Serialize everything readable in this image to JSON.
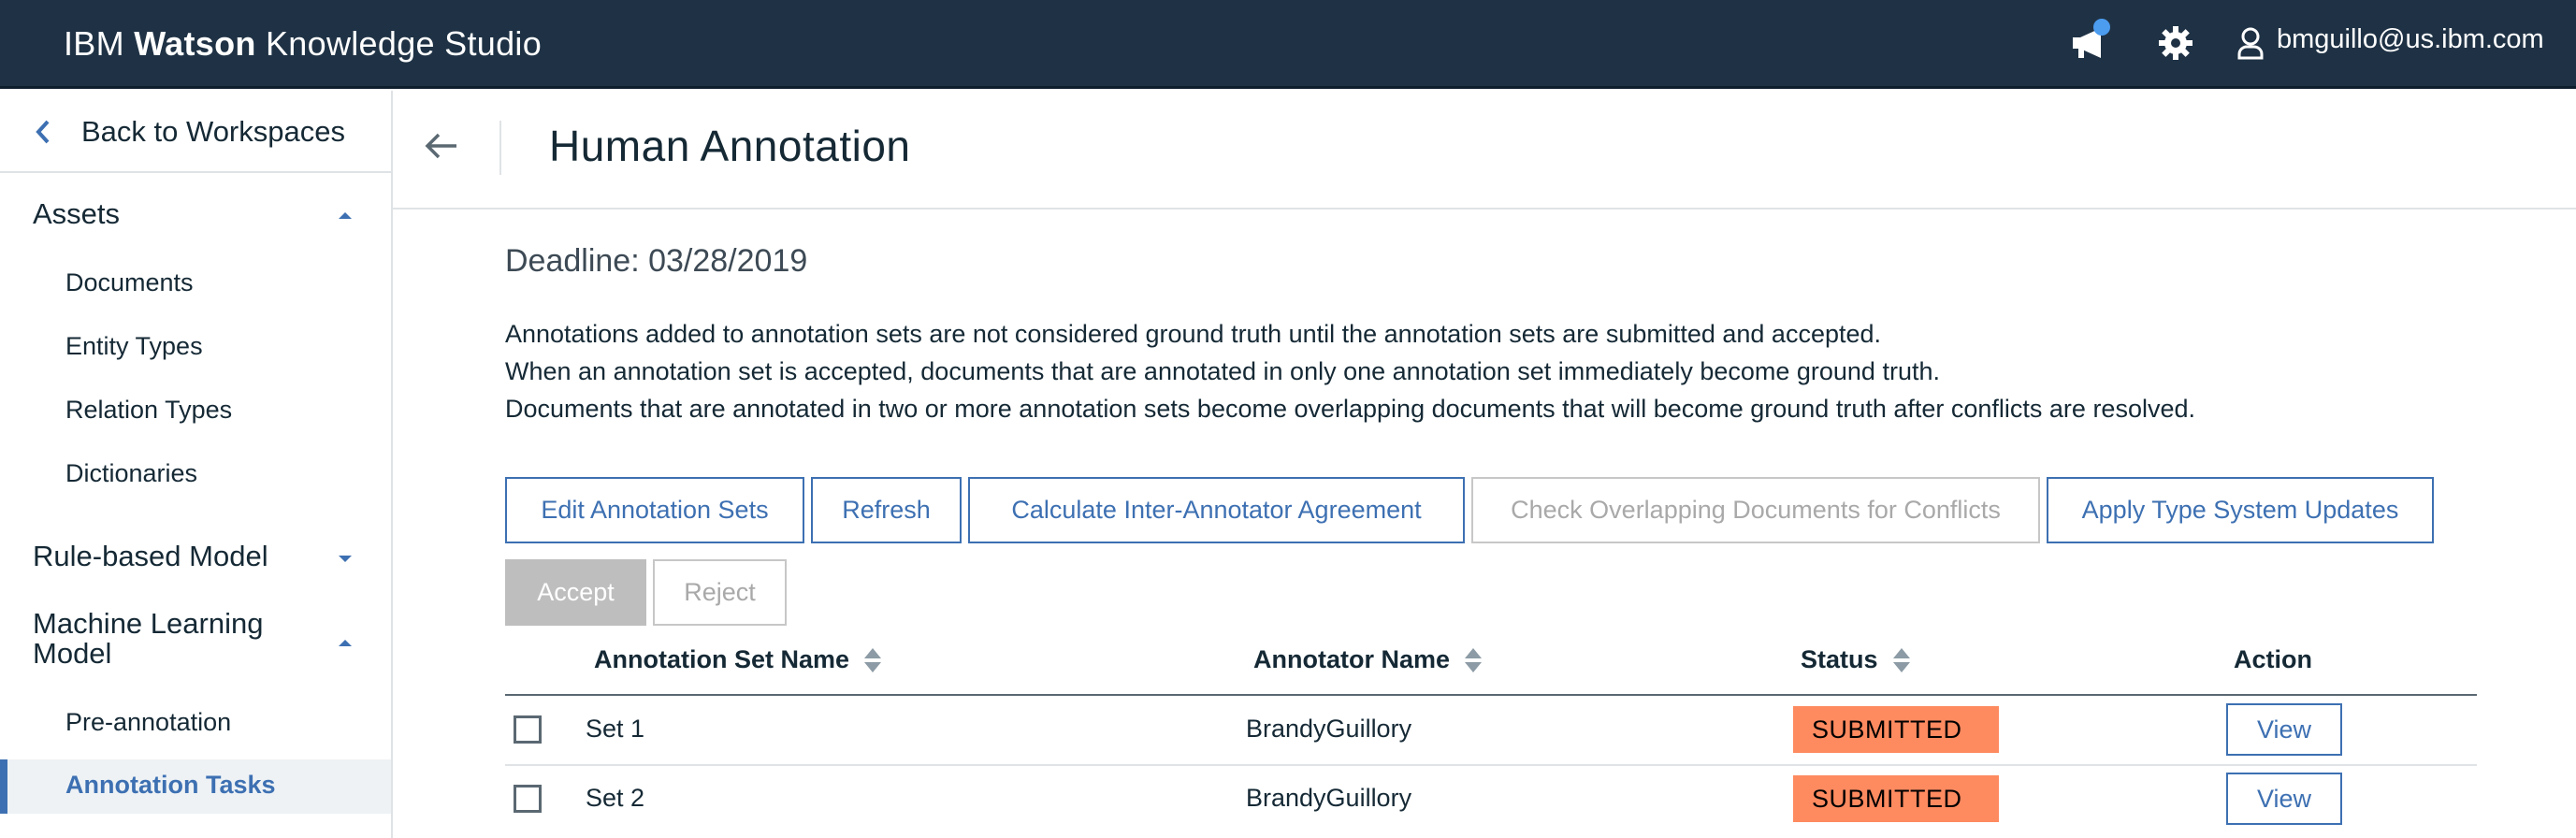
{
  "header": {
    "brand_prefix": "IBM",
    "brand_bold": "Watson",
    "brand_suffix": "Knowledge Studio",
    "user_email": "bmguillo@us.ibm.com",
    "icons": [
      "megaphone-icon",
      "gear-icon",
      "user-icon"
    ]
  },
  "sidebar": {
    "back_label": "Back to Workspaces",
    "sections": [
      {
        "label": "Assets",
        "expanded": true,
        "items": [
          "Documents",
          "Entity Types",
          "Relation Types",
          "Dictionaries"
        ]
      },
      {
        "label": "Rule-based Model",
        "expanded": false,
        "items": []
      },
      {
        "label_line1": "Machine Learning",
        "label_line2": "Model",
        "expanded": true,
        "items": [
          "Pre-annotation",
          "Annotation Tasks"
        ]
      }
    ],
    "active_item": "Annotation Tasks"
  },
  "main": {
    "title": "Human Annotation",
    "deadline": "Deadline: 03/28/2019",
    "description": [
      "Annotations added to annotation sets are not considered ground truth until the annotation sets are submitted and accepted.",
      "When an annotation set is accepted, documents that are annotated in only one annotation set immediately become ground truth.",
      "Documents that are annotated in two or more annotation sets become overlapping documents that will become ground truth after conflicts are resolved."
    ],
    "buttons": {
      "edit_sets": "Edit Annotation Sets",
      "refresh": "Refresh",
      "calc_iaa": "Calculate Inter-Annotator Agreement",
      "check_overlap": "Check Overlapping Documents for Conflicts",
      "apply_type": "Apply Type System Updates",
      "accept": "Accept",
      "reject": "Reject"
    },
    "table": {
      "columns": [
        "Annotation Set Name",
        "Annotator Name",
        "Status",
        "Action"
      ],
      "rows": [
        {
          "set": "Set 1",
          "annotator": "BrandyGuillory",
          "status": "SUBMITTED",
          "action": "View"
        },
        {
          "set": "Set 2",
          "annotator": "BrandyGuillory",
          "status": "SUBMITTED",
          "action": "View"
        }
      ]
    }
  },
  "colors": {
    "topbar": "#1f3245",
    "accent": "#3d70b2",
    "status_submitted": "#fe8a60",
    "accept_disabled": "#bebebe"
  }
}
